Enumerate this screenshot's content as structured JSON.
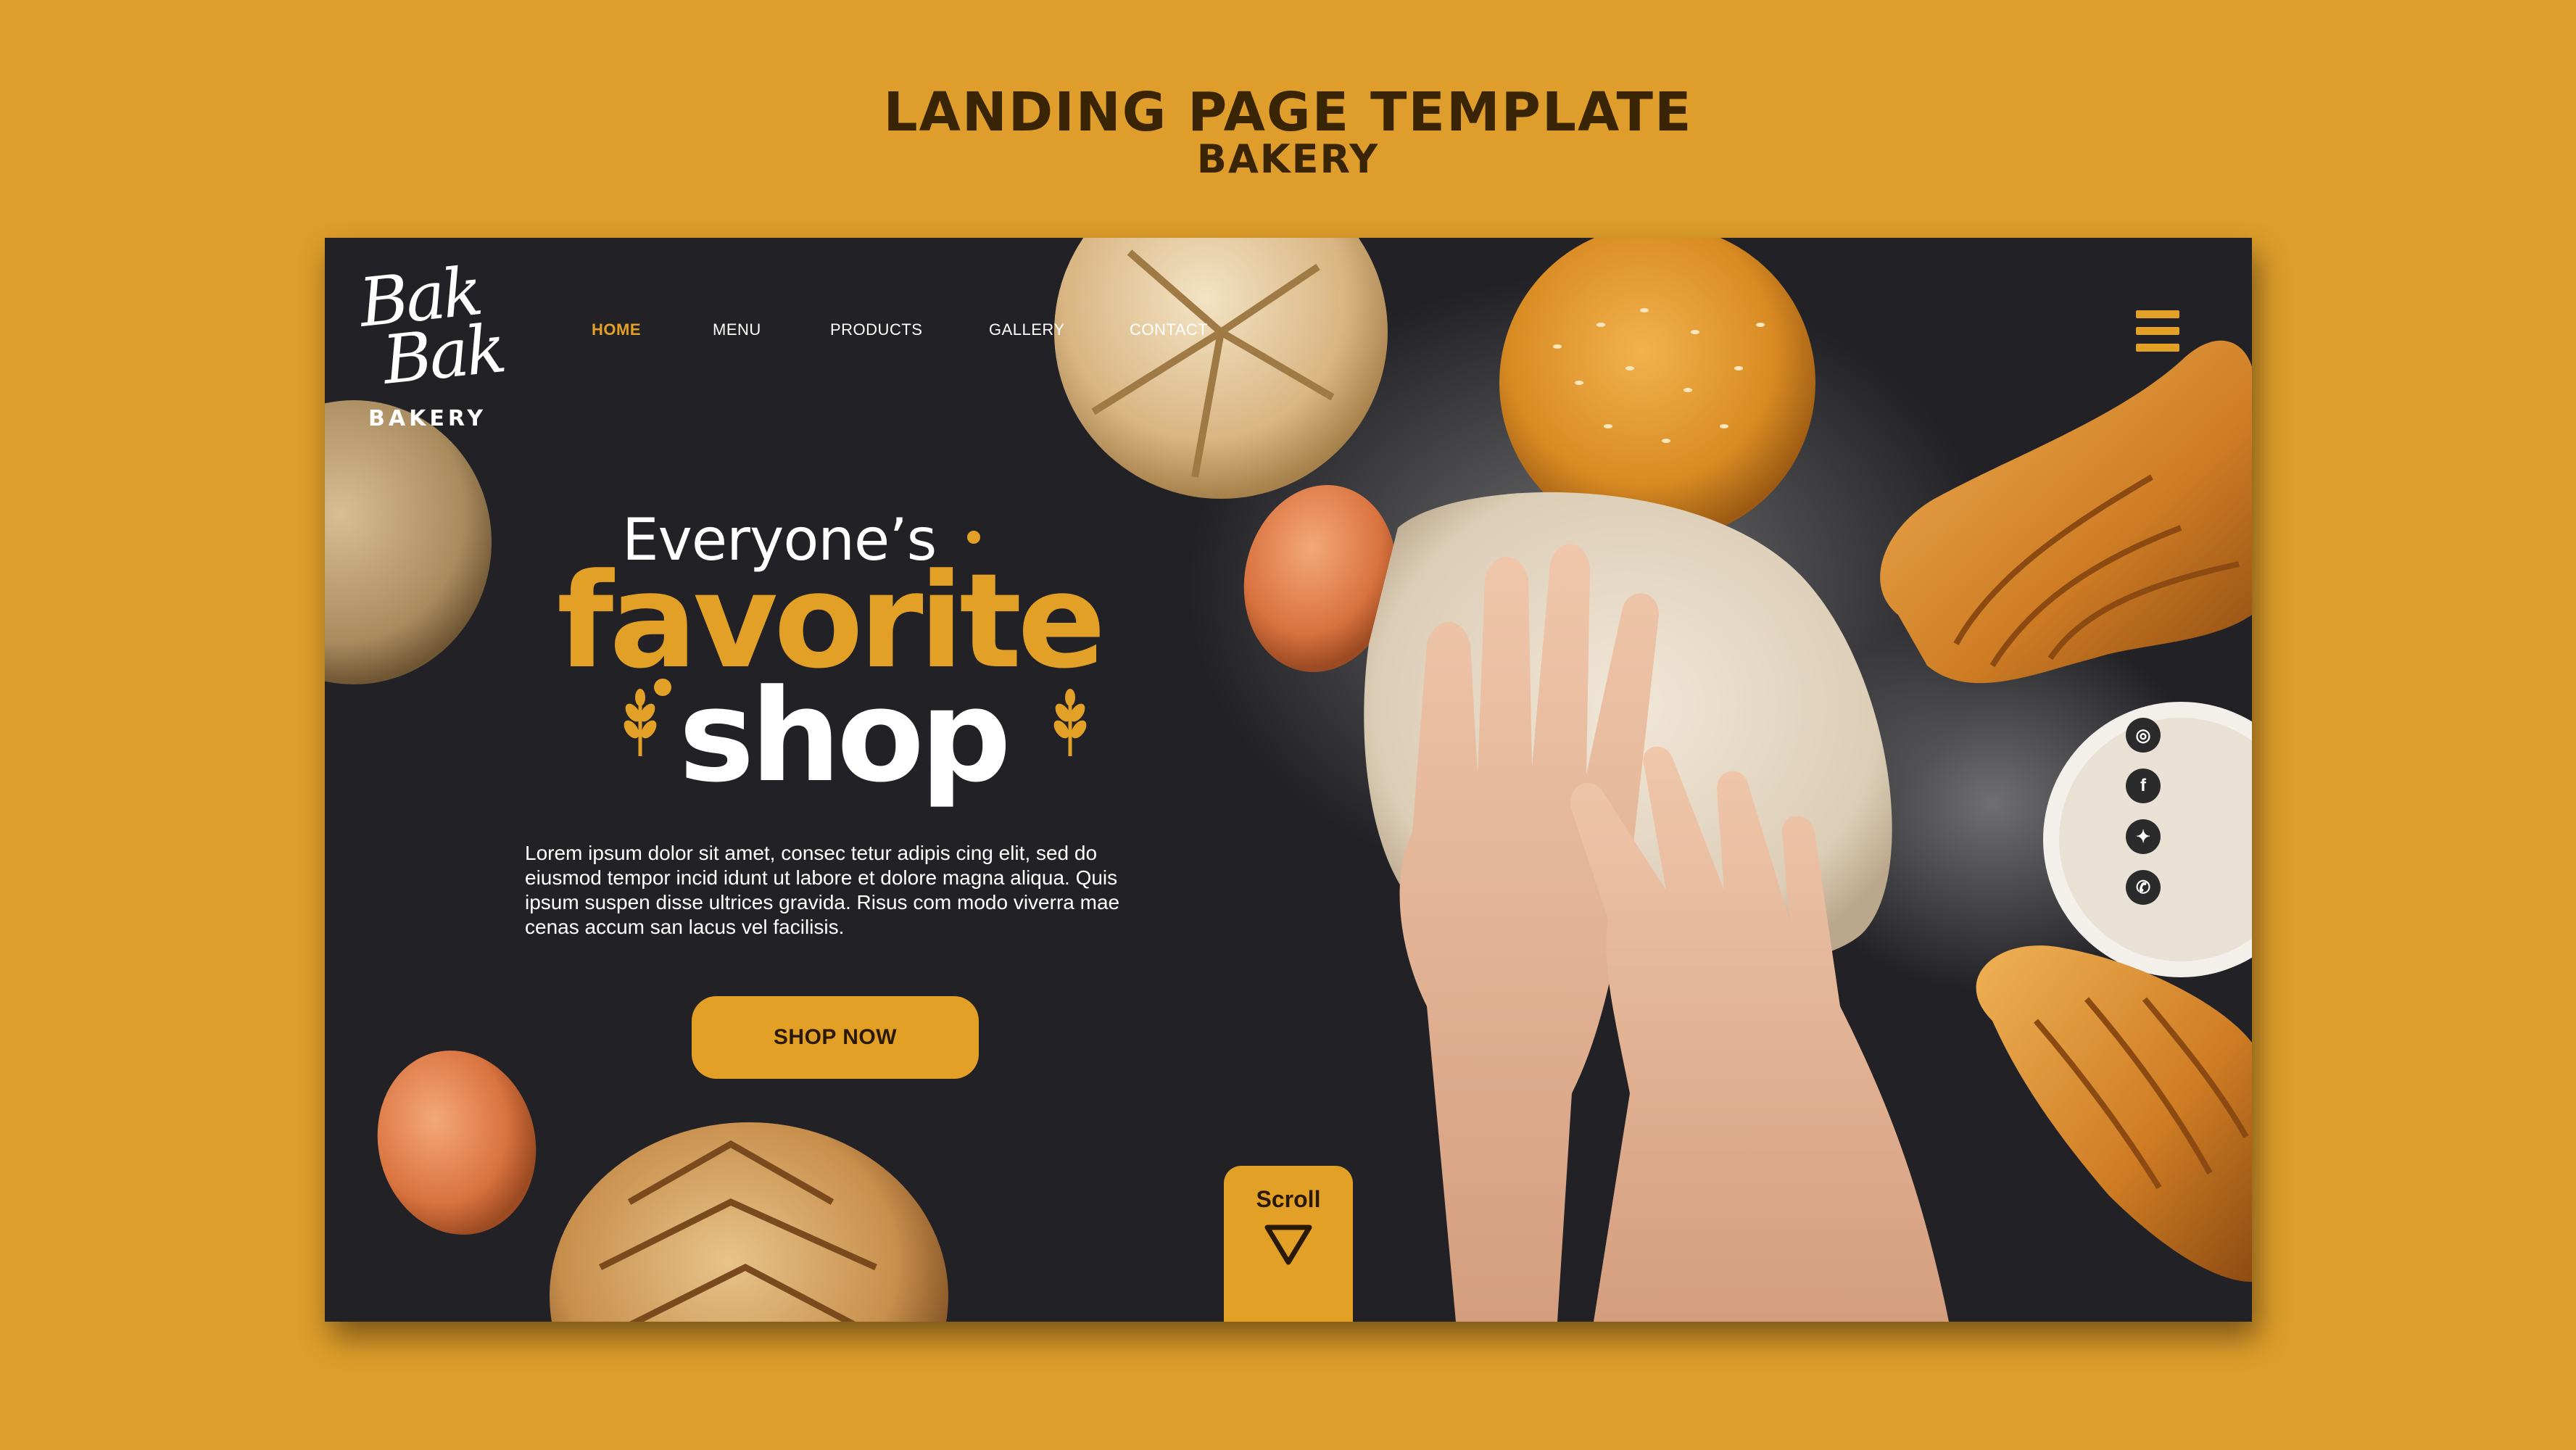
{
  "outer": {
    "title": "LANDING PAGE TEMPLATE",
    "subtitle": "BAKERY"
  },
  "colors": {
    "background": "#DF9E2B",
    "card": "#222226",
    "accent": "#E3A027",
    "text_light": "#FFFFFF",
    "text_dark": "#3A2406"
  },
  "logo": {
    "script_line1": "Bak",
    "script_line2": "Bak",
    "sub": "BAKERY"
  },
  "nav": {
    "items": [
      {
        "label": "HOME",
        "active": true
      },
      {
        "label": "MENU",
        "active": false
      },
      {
        "label": "PRODUCTS",
        "active": false
      },
      {
        "label": "GALLERY",
        "active": false
      },
      {
        "label": "CONTACT",
        "active": false
      }
    ],
    "menu_icon": "hamburger-icon"
  },
  "hero": {
    "line1": "Everyone’s",
    "line2": "favorite",
    "line3": "shop",
    "body": "Lorem ipsum dolor sit amet, consec tetur adipis cing elit, sed do eiusmod tempor incid idunt ut labore et dolore magna aliqua. Quis ipsum suspen disse ultrices gravida. Risus com modo viverra mae cenas accum san lacus vel facilisis.",
    "cta": "SHOP NOW",
    "decor_icon": "wheat-icon"
  },
  "scroll": {
    "label": "Scroll",
    "icon": "triangle-down-icon"
  },
  "social": [
    {
      "icon": "instagram-icon",
      "glyph": "◎"
    },
    {
      "icon": "facebook-icon",
      "glyph": "f"
    },
    {
      "icon": "twitter-icon",
      "glyph": "✦"
    },
    {
      "icon": "whatsapp-icon",
      "glyph": "✆"
    }
  ]
}
